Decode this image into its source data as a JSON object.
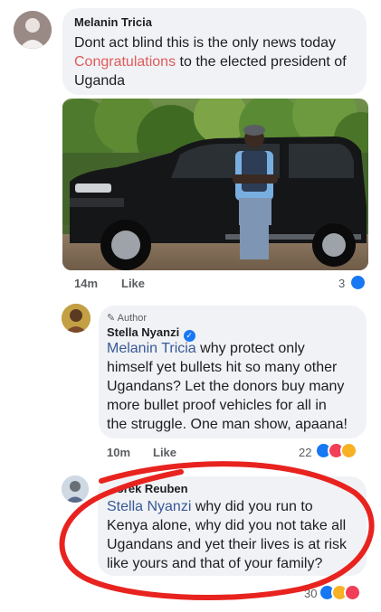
{
  "comment1": {
    "author": "Melanin Tricia",
    "line1": "Dont act blind this is the only news today",
    "congrats": "Congratulations",
    "line2_rest": " to the elected president of",
    "line3": "Uganda",
    "time": "14m",
    "like_label": "Like",
    "reaction_count": "3",
    "photo_alt": "Man in bulletproof vest standing beside black SUV"
  },
  "comment2": {
    "badge": "Author",
    "author": "Stella Nyanzi",
    "mention": "Melanin Tricia",
    "text_lines": [
      " why protect only",
      "himself yet bullets hit so many other",
      "Ugandans? Let the donors buy many",
      "more bullet proof vehicles for all in",
      "the struggle. One man show, apaana!"
    ],
    "time": "10m",
    "like_label": "Like",
    "reaction_count": "22"
  },
  "comment3": {
    "author": "...orek Reuben",
    "mention": "Stella Nyanzi",
    "text_lines": [
      " why did you run to",
      "Kenya alone, why did you not take all",
      "Ugandans and yet their lives is at risk",
      "like yours and that of your family?"
    ],
    "reaction_count": "30"
  },
  "colors": {
    "link": "#385898",
    "congrats": "#e05a5a",
    "annotation_circle": "#e8231f"
  }
}
